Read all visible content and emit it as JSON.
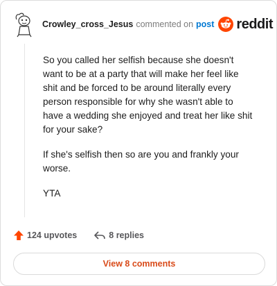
{
  "comment": {
    "username": "Crowley_cross_Jesus",
    "action_text": "commented on",
    "post_link": "post",
    "brand": "reddit",
    "paragraphs": [
      "So you called her selfish because she doesn't want to be at a party that will make her feel like shit and be forced to be around literally every person responsible for why she wasn't able to have a wedding she enjoyed and treat her like shit for your sake?",
      "If she's selfish then so are you and frankly your worse.",
      "YTA"
    ]
  },
  "footer": {
    "upvotes": "124 upvotes",
    "replies": "8 replies",
    "view_comments": "View 8 comments"
  },
  "colors": {
    "reddit_orange": "#ff4500",
    "link_blue": "#0079d3",
    "view_button_text": "#d94b1a"
  },
  "icons": [
    "avatar-icon",
    "reddit-logo-icon",
    "upvote-arrow-icon",
    "reply-arrow-icon"
  ]
}
